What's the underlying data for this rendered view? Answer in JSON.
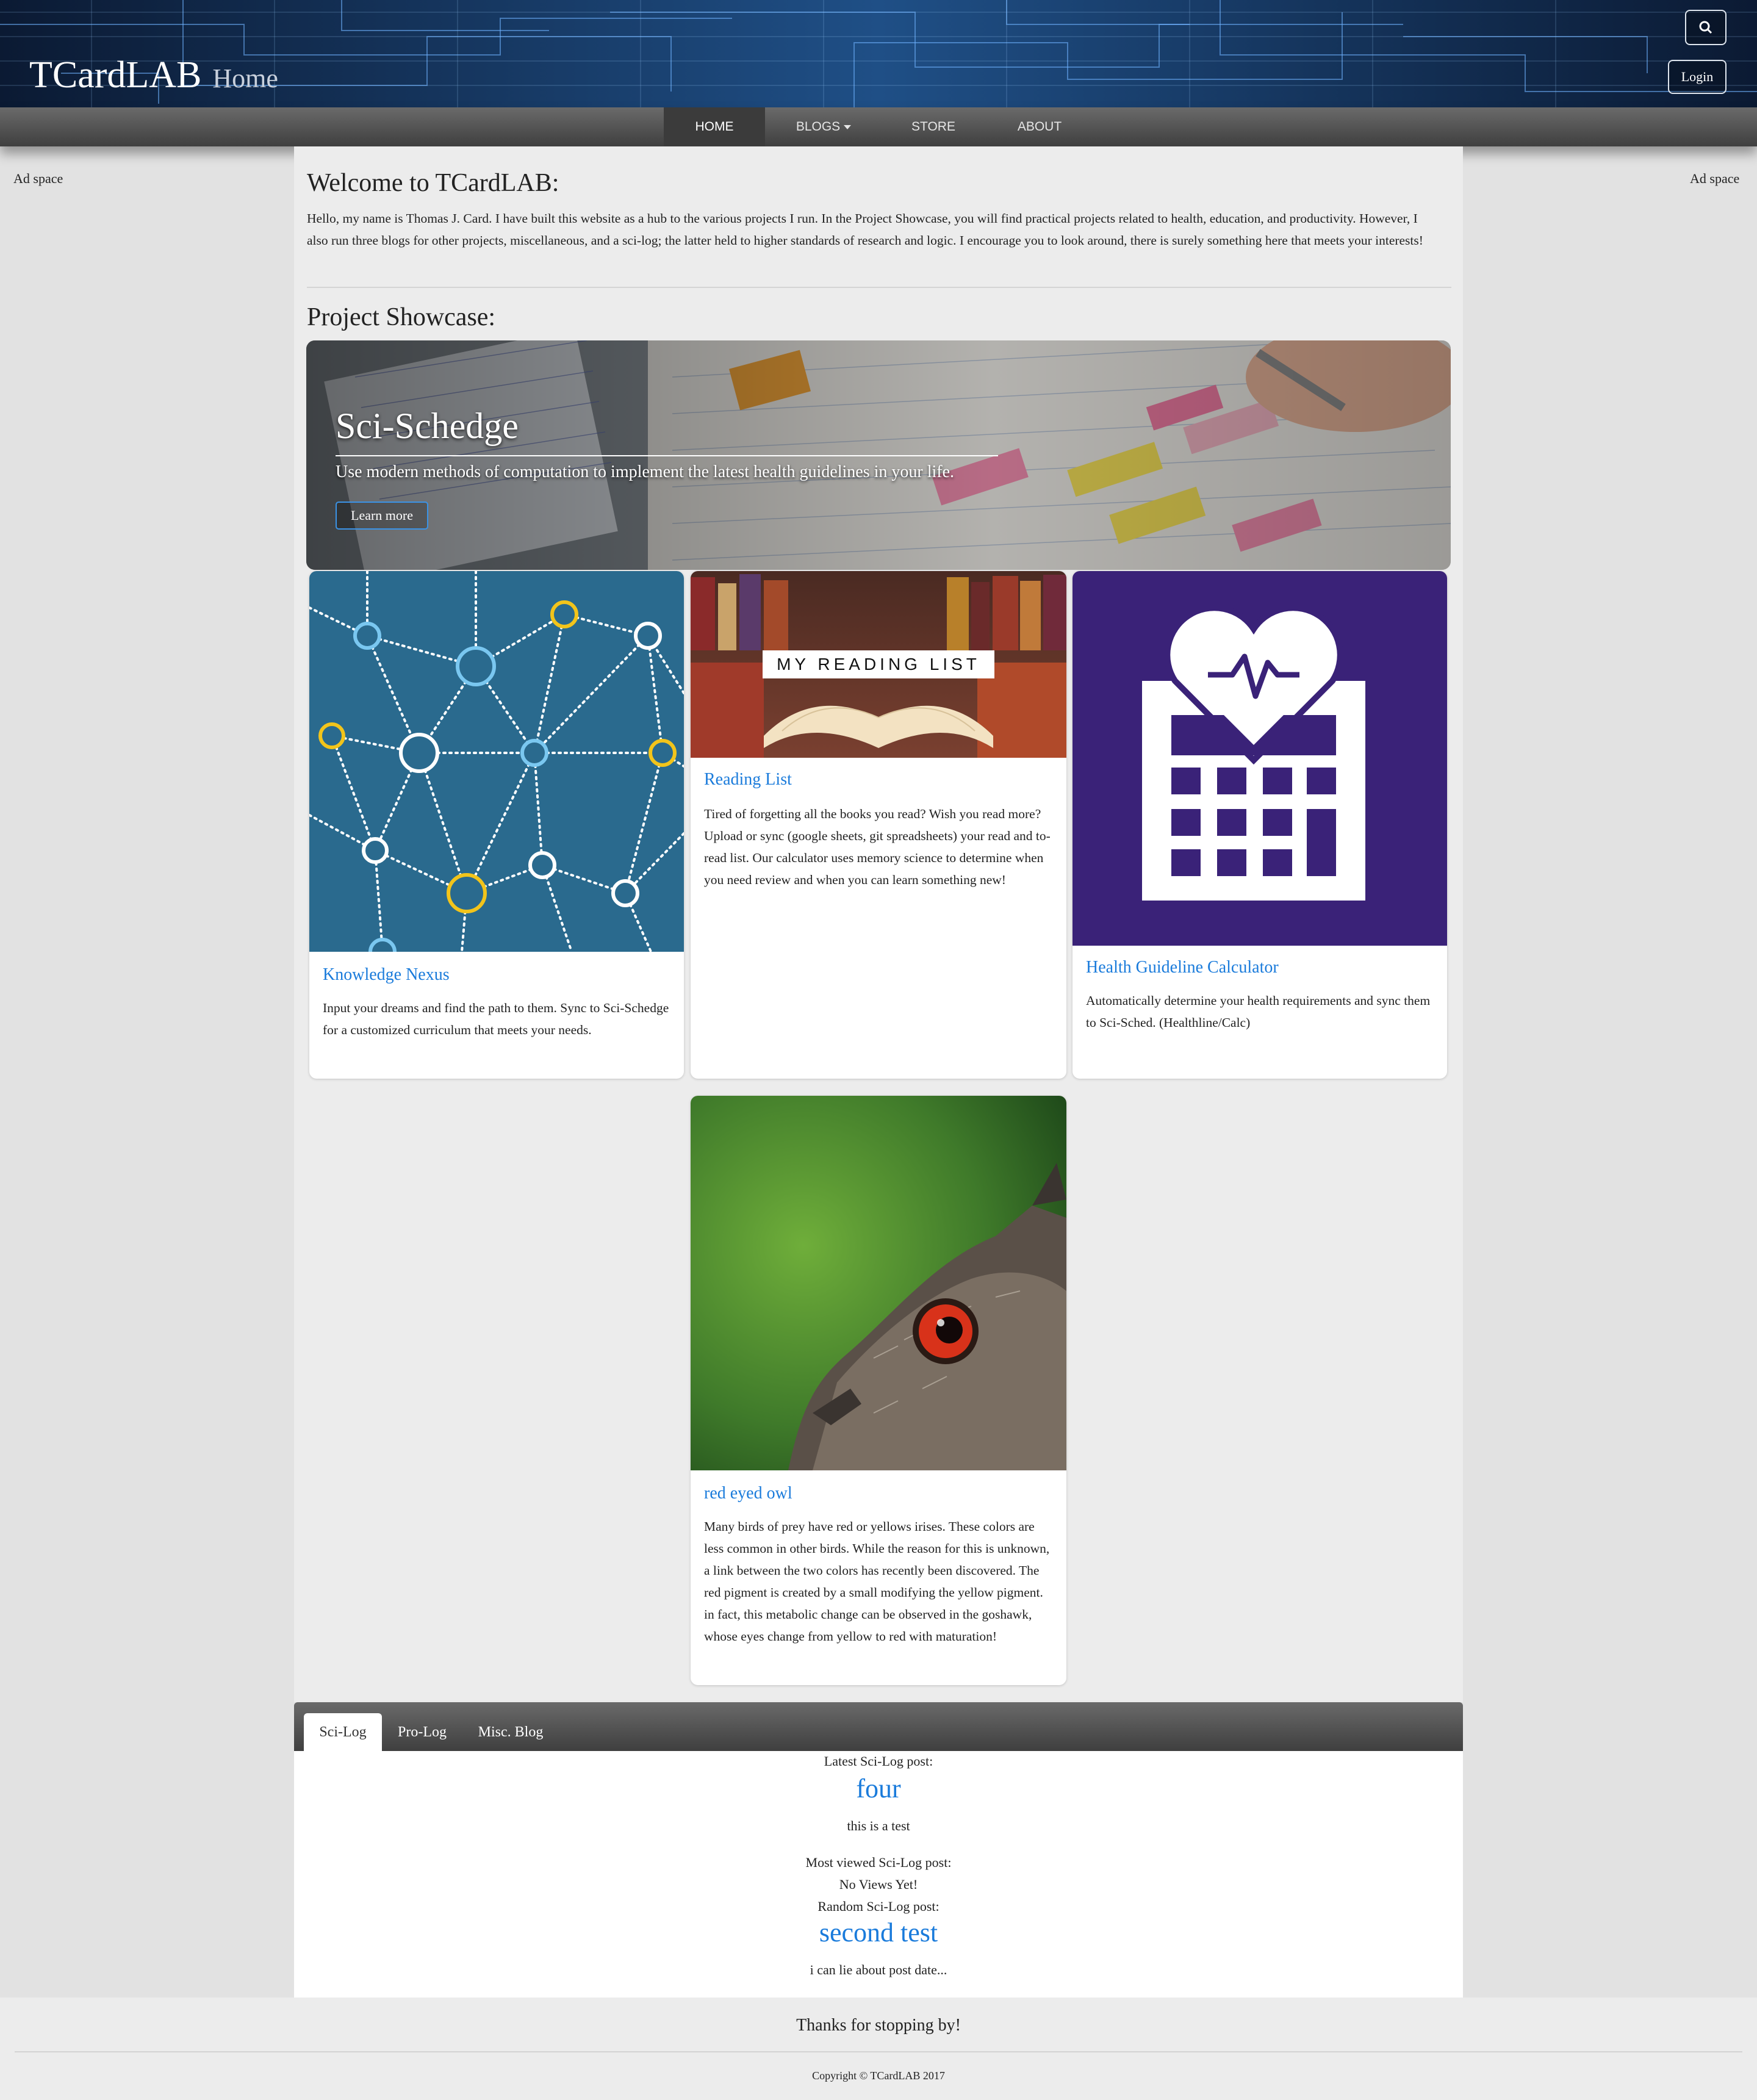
{
  "header": {
    "brand": "TCardLAB",
    "subtitle": "Home",
    "login_label": "Login",
    "search_icon": "search-icon"
  },
  "nav": {
    "items": [
      {
        "label": "HOME",
        "active": true
      },
      {
        "label": "BLOGS",
        "dropdown": true
      },
      {
        "label": "STORE"
      },
      {
        "label": "ABOUT"
      }
    ]
  },
  "ads": {
    "left": "Ad space",
    "right": "Ad space"
  },
  "welcome": {
    "title": "Welcome to TCardLAB:",
    "text": "Hello, my name is Thomas J. Card. I have built this website as a hub to the various projects I run. In the Project Showcase, you will find practical projects related to health, education, and productivity. However, I also run three blogs for other projects, miscellaneous, and a sci-log; the latter held to higher standards of research and logic. I encourage you to look around, there is surely something here that meets your interests!"
  },
  "showcase": {
    "title": "Project Showcase:",
    "hero": {
      "title": "Sci-Schedge",
      "description": "Use modern methods of computation to implement the latest health guidelines in your life.",
      "button": "Learn more"
    },
    "cards": [
      {
        "title": "Knowledge Nexus",
        "text": "Input your dreams and find the path to them. Sync to Sci-Schedge for a customized curriculum that meets your needs."
      },
      {
        "title": "Reading List",
        "image_text": "MY READING LIST",
        "text": "Tired of forgetting all the books you read? Wish you read more? Upload or sync (google sheets, git spreadsheets) your read and to-read list. Our calculator uses memory science to determine when you need review and when you can learn something new!"
      },
      {
        "title": "Health Guideline Calculator",
        "text": "Automatically determine your health requirements and sync them to Sci-Sched. (Healthline/Calc)"
      },
      {
        "title": "red eyed owl",
        "text": "Many birds of prey have red or yellows irises. These colors are less common in other birds. While the reason for this is unknown, a link between the two colors has recently been discovered. The red pigment is created by a small modifying the yellow pigment. in fact, this metabolic change can be observed in the goshawk, whose eyes change from yellow to red with maturation!"
      }
    ]
  },
  "blogs": {
    "tabs": [
      "Sci-Log",
      "Pro-Log",
      "Misc. Blog"
    ],
    "latest_label": "Latest Sci-Log post:",
    "latest_title": "four",
    "latest_excerpt": "this is a test",
    "most_viewed_label": "Most viewed Sci-Log post:",
    "most_viewed_value": "No Views Yet!",
    "random_label": "Random Sci-Log post:",
    "random_title": "second test",
    "random_excerpt": "i can lie about post date..."
  },
  "footer": {
    "thanks": "Thanks for stopping by!",
    "copyright": "Copyright © TCardLAB 2017"
  },
  "colors": {
    "link": "#1a7bdb",
    "nav": "#4f4f4f",
    "health_bg": "#3a2278",
    "nexus_bg": "#2a6a8e"
  }
}
